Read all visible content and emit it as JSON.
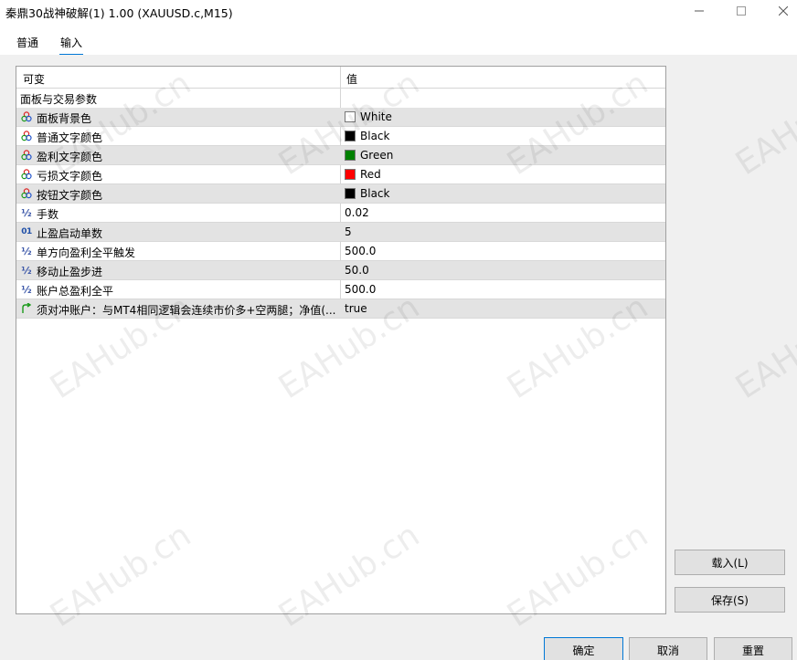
{
  "window": {
    "title": "秦鼎30战神破解(1) 1.00 (XAUUSD.c,M15)",
    "minimize_label": "—",
    "maximize_label": "☐",
    "close_label": "✕"
  },
  "tabs": [
    {
      "label": "普通"
    },
    {
      "label": "输入",
      "active": true
    }
  ],
  "grid": {
    "col_variable": "可变",
    "col_value": "值",
    "group_label": "面板与交易参数",
    "rows": [
      {
        "name": "面板背景色",
        "type": "color",
        "value": "White",
        "color": "#ffffff",
        "icon": "color-icon"
      },
      {
        "name": "普通文字颜色",
        "type": "color",
        "value": "Black",
        "color": "#000000",
        "icon": "color-icon"
      },
      {
        "name": "盈利文字颜色",
        "type": "color",
        "value": "Green",
        "color": "#008000",
        "icon": "color-icon"
      },
      {
        "name": "亏损文字颜色",
        "type": "color",
        "value": "Red",
        "color": "#ff0000",
        "icon": "color-icon"
      },
      {
        "name": "按钮文字颜色",
        "type": "color",
        "value": "Black",
        "color": "#000000",
        "icon": "color-icon"
      },
      {
        "name": "手数",
        "type": "double",
        "value": "0.02",
        "icon": "fraction-icon"
      },
      {
        "name": "止盈启动单数",
        "type": "int",
        "value": "5",
        "icon": "integer-icon"
      },
      {
        "name": "单方向盈利全平触发",
        "type": "double",
        "value": "500.0",
        "icon": "fraction-icon"
      },
      {
        "name": "移动止盈步进",
        "type": "double",
        "value": "50.0",
        "icon": "fraction-icon"
      },
      {
        "name": "账户总盈利全平",
        "type": "double",
        "value": "500.0",
        "icon": "fraction-icon"
      },
      {
        "name": "须对冲账户：与MT4相同逻辑会连续市价多+空两腿；净值(...",
        "type": "bool",
        "value": "true",
        "icon": "boolean-icon"
      }
    ]
  },
  "watermark": "EAHub.cn",
  "buttons": {
    "load": "载入(L)",
    "save": "保存(S)",
    "ok": "确定",
    "cancel": "取消",
    "reset": "重置"
  }
}
